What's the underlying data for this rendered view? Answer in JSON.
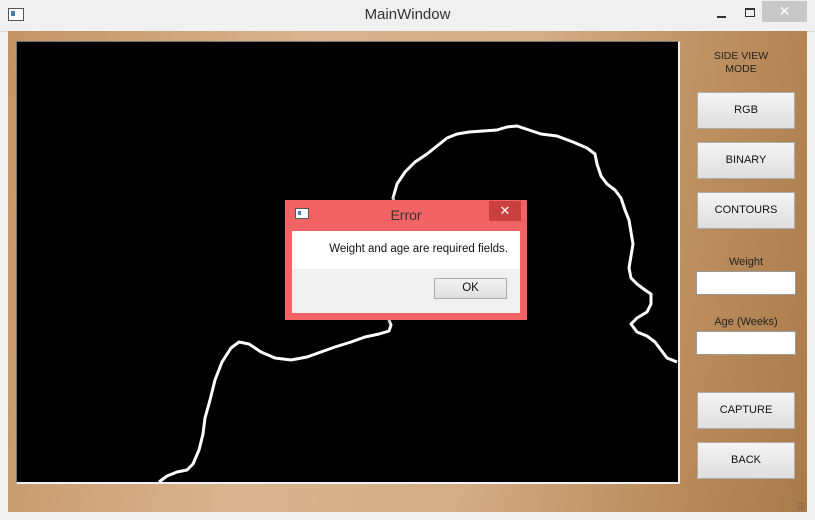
{
  "window": {
    "title": "MainWindow",
    "close_glyph": "✕"
  },
  "sidebar": {
    "mode_label": "SIDE VIEW\nMODE",
    "rgb_label": "RGB",
    "binary_label": "BINARY",
    "contours_label": "CONTOURS",
    "weight_label": "Weight",
    "weight_value": "",
    "age_label": "Age (Weeks)",
    "age_value": "",
    "capture_label": "CAPTURE",
    "back_label": "BACK"
  },
  "dialog": {
    "title": "Error",
    "close_glyph": "✕",
    "message": "Weight and age are required fields.",
    "ok_label": "OK"
  },
  "colors": {
    "dialog_frame": "#f26464",
    "dialog_close": "#c84040",
    "viewport_bg": "#000000",
    "contour_stroke": "#ffffff"
  },
  "icons": {
    "app": "app-window-icon",
    "dialog": "dialog-window-icon",
    "minimize": "minimize-icon",
    "maximize": "maximize-icon",
    "close": "close-icon",
    "resize": "resize-grip-icon"
  }
}
